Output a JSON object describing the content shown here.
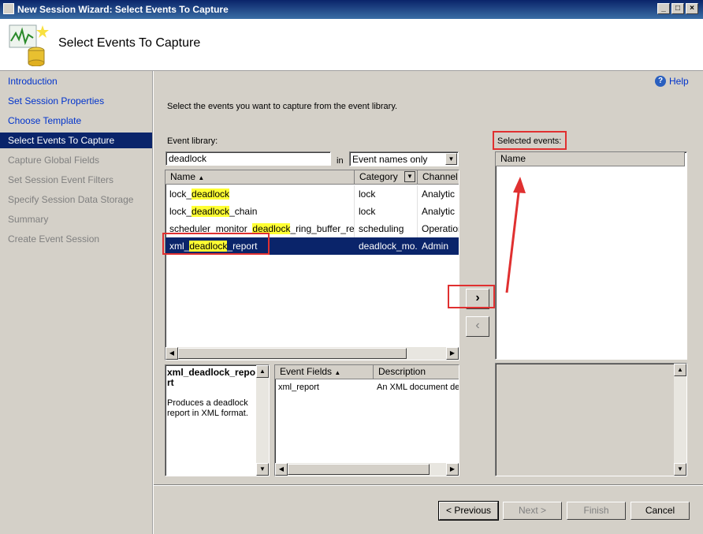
{
  "window": {
    "title": "New Session Wizard: Select Events To Capture"
  },
  "header": {
    "title": "Select Events To Capture"
  },
  "nav": {
    "items": [
      {
        "label": "Introduction",
        "state": "link"
      },
      {
        "label": "Set Session Properties",
        "state": "link"
      },
      {
        "label": "Choose Template",
        "state": "link"
      },
      {
        "label": "Select Events To Capture",
        "state": "active"
      },
      {
        "label": "Capture Global Fields",
        "state": "disabled"
      },
      {
        "label": "Set Session Event Filters",
        "state": "disabled"
      },
      {
        "label": "Specify Session Data Storage",
        "state": "disabled"
      },
      {
        "label": "Summary",
        "state": "disabled"
      },
      {
        "label": "Create Event Session",
        "state": "disabled"
      }
    ]
  },
  "help": {
    "label": "Help"
  },
  "instructions": "Select the events you want to capture from the event library.",
  "library": {
    "label": "Event library:",
    "search_value": "deadlock",
    "in_label": "in",
    "filter_selected": "Event names only",
    "columns": {
      "name": "Name",
      "category": "Category",
      "channel": "Channel"
    },
    "rows": [
      {
        "pre": "lock_",
        "hl": "deadlock",
        "post": "",
        "category": "lock",
        "channel": "Analytic"
      },
      {
        "pre": "lock_",
        "hl": "deadlock",
        "post": "_chain",
        "category": "lock",
        "channel": "Analytic"
      },
      {
        "pre": "scheduler_monitor_",
        "hl": "deadlock",
        "post": "_ring_buffer_recor...",
        "category": "scheduling",
        "channel": "Operation"
      },
      {
        "pre": "xml_",
        "hl": "deadlock",
        "post": "_report",
        "category": "deadlock_mo...",
        "channel": "Admin"
      }
    ]
  },
  "description": {
    "title": "xml_deadlock_report",
    "text": "Produces a deadlock report in XML format."
  },
  "event_fields": {
    "columns": {
      "field": "Event Fields",
      "description": "Description"
    },
    "rows": [
      {
        "field": "xml_report",
        "description": "An XML document de"
      }
    ]
  },
  "selected": {
    "label": "Selected events:",
    "columns": {
      "name": "Name"
    }
  },
  "buttons": {
    "add": "›",
    "remove": "‹",
    "previous": "< Previous",
    "next": "Next >",
    "finish": "Finish",
    "cancel": "Cancel"
  },
  "colors": {
    "selection": "#0a246a",
    "highlight": "#ffff33",
    "annotation": "#e03030",
    "link": "#0033cc"
  }
}
